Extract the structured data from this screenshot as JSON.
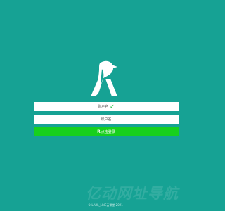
{
  "logo": {
    "icon": "bird-r-logo-icon"
  },
  "form": {
    "account_placeholder": "账户名",
    "account_status_icon": "check-icon",
    "account_status_symbol": "✓",
    "password_placeholder": "账户名"
  },
  "login_button": {
    "icon": "logo-small-icon",
    "icon_glyph": "R",
    "label": "点击登录"
  },
  "watermark": "亿动网址导航",
  "footer": {
    "copyright": "© LARL_LINE云课堂 2021"
  },
  "colors": {
    "background": "#16a294",
    "button": "#17d01d",
    "check": "#1bbf3a",
    "field": "#ffffff"
  }
}
